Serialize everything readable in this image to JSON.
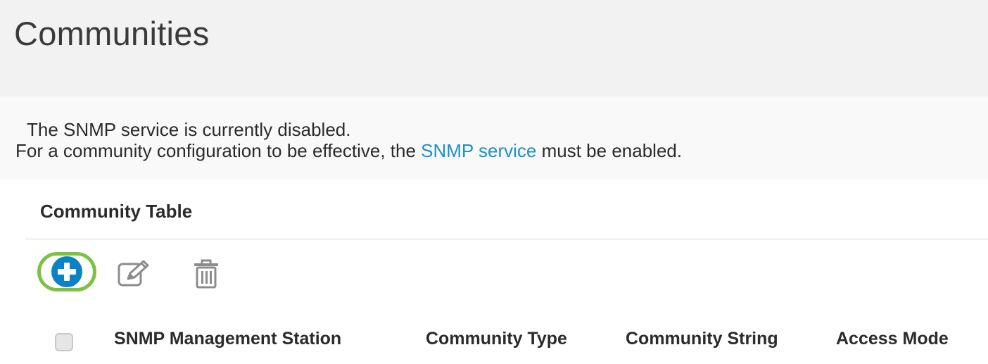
{
  "page": {
    "title": "Communities"
  },
  "notice": {
    "line1": "The SNMP service is currently disabled.",
    "line2_before": "For a community configuration to be effective, the ",
    "line2_link": "SNMP service",
    "line2_after": " must be enabled."
  },
  "table": {
    "title": "Community Table",
    "toolbar": {
      "add_icon": "plus-circle-icon",
      "edit_icon": "edit-icon",
      "delete_icon": "trash-icon"
    },
    "columns": [
      "SNMP Management Station",
      "Community Type",
      "Community String",
      "Access Mode"
    ]
  },
  "colors": {
    "accent_blue": "#0a82c5",
    "link_blue": "#1c8fc9",
    "highlight_green": "#7cc242"
  }
}
